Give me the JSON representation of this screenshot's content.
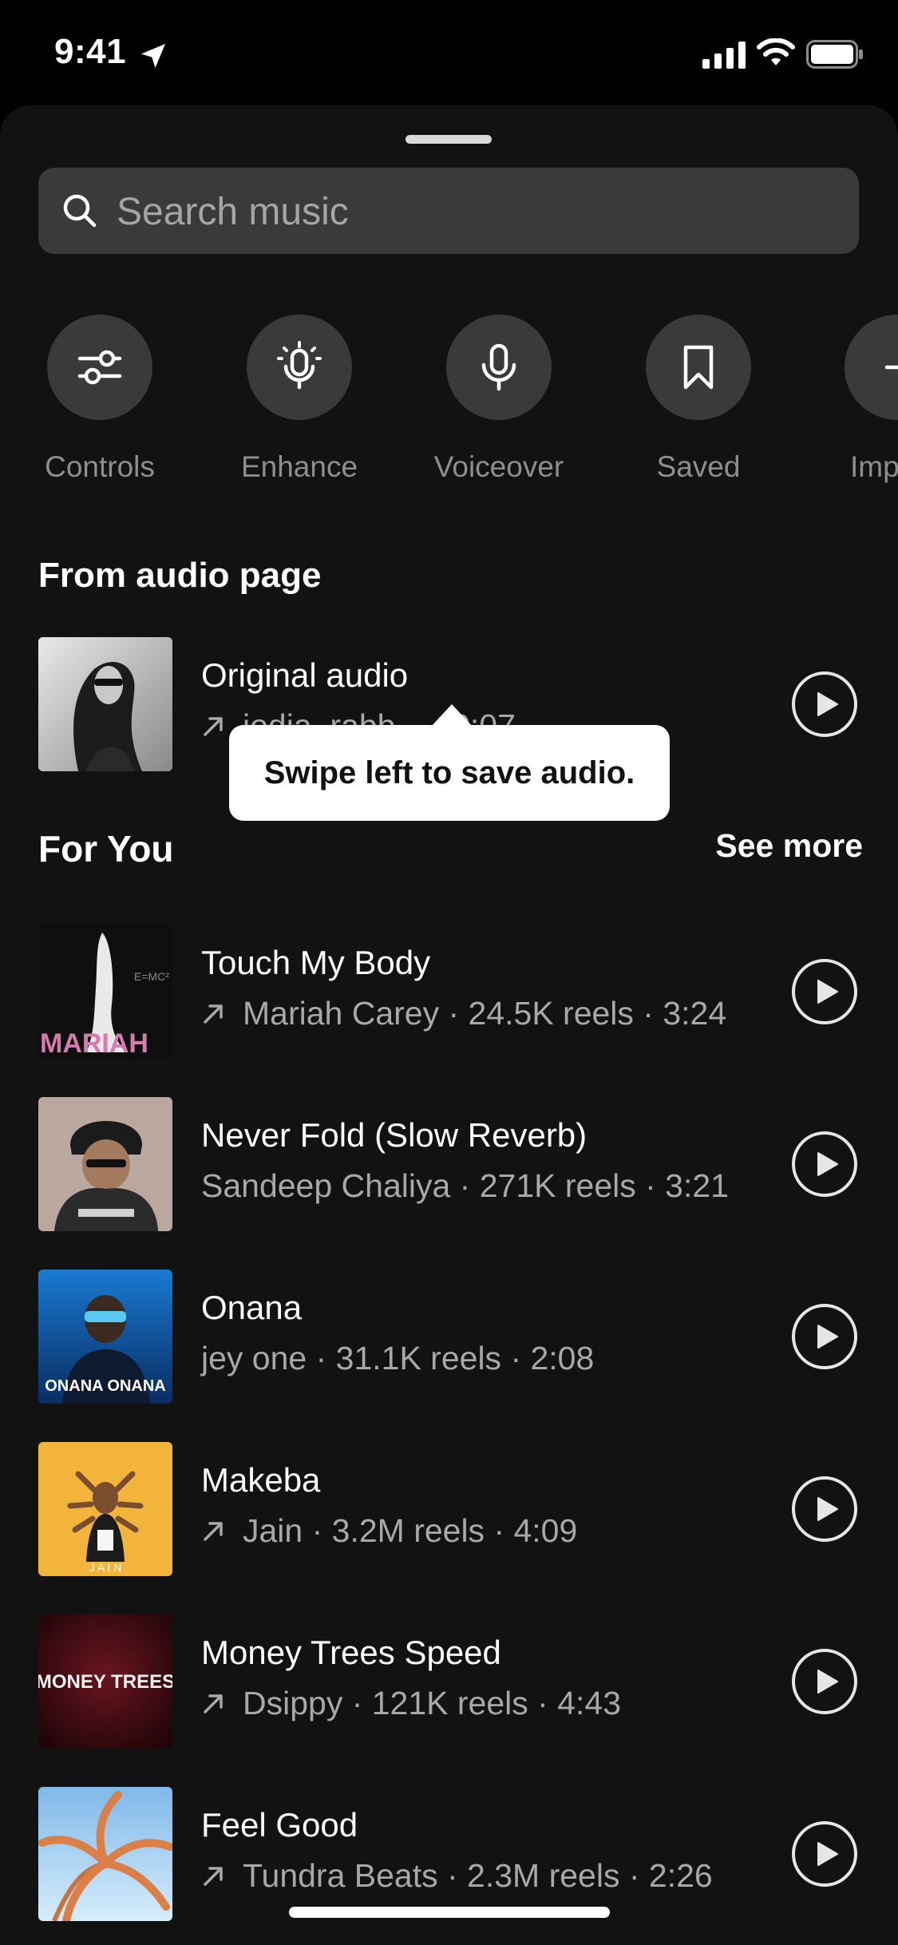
{
  "status_bar": {
    "time": "9:41"
  },
  "search": {
    "placeholder": "Search music"
  },
  "tools": [
    {
      "label": "Controls",
      "icon": "sliders-icon"
    },
    {
      "label": "Enhance",
      "icon": "mic-sparkle-icon"
    },
    {
      "label": "Voiceover",
      "icon": "microphone-icon"
    },
    {
      "label": "Saved",
      "icon": "bookmark-icon"
    },
    {
      "label": "Imp",
      "icon": "import-icon"
    }
  ],
  "audio_page": {
    "title": "From audio page",
    "track": {
      "title": "Original audio",
      "meta": "jodia_rabb... · 0:07"
    }
  },
  "tooltip": {
    "text": "Swipe left to save audio."
  },
  "for_you": {
    "title": "For You",
    "see_more": "See more",
    "tracks": [
      {
        "title": "Touch My Body",
        "meta": "Mariah Carey · 24.5K reels · 3:24",
        "trending": true
      },
      {
        "title": "Never Fold (Slow Reverb)",
        "meta": "Sandeep Chaliya · 271K reels · 3:21",
        "trending": false
      },
      {
        "title": "Onana",
        "meta": "jey one · 31.1K reels · 2:08",
        "trending": false
      },
      {
        "title": "Makeba",
        "meta": "Jain · 3.2M reels · 4:09",
        "trending": true
      },
      {
        "title": "Money Trees Speed",
        "meta": "Dsippy · 121K reels · 4:43",
        "trending": true
      },
      {
        "title": "Feel Good",
        "meta": "Tundra Beats · 2.3M reels · 2:26",
        "trending": true
      }
    ]
  },
  "cover_art": {
    "mariah_text": "MARIAH",
    "onana_text": "ONANA ONANA",
    "jain_text": "J A I N",
    "money_trees_text": "MONEY TREES"
  },
  "colors": {
    "sheet_bg": "#121212",
    "control_bg": "#3a3a3a",
    "muted_text": "#a8a8a8"
  }
}
